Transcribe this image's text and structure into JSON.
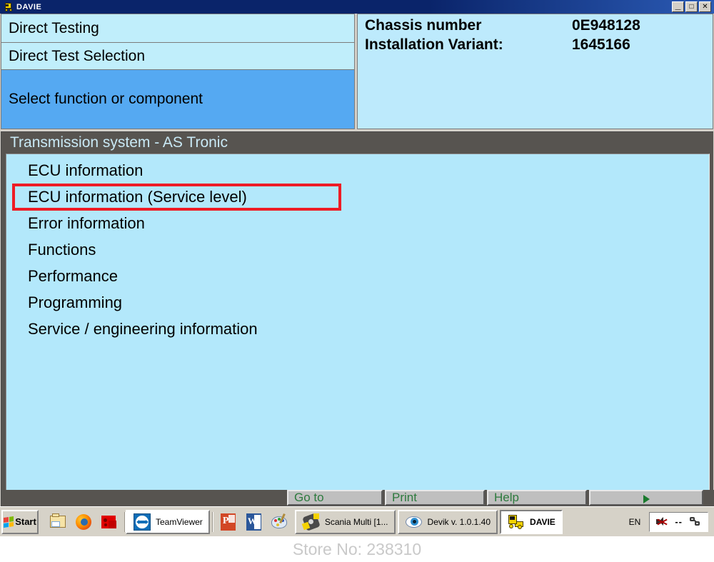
{
  "window": {
    "title": "DAVIE",
    "icon": "truck-icon",
    "controls": {
      "minimize": "_",
      "maximize": "□",
      "close": "✕"
    }
  },
  "breadcrumbs": [
    {
      "label": "Direct Testing",
      "selected": false
    },
    {
      "label": "Direct Test Selection",
      "selected": false
    },
    {
      "label": "Select function or component",
      "selected": true
    }
  ],
  "vehicle_info": [
    {
      "label": "Chassis number",
      "value": "0E948128"
    },
    {
      "label": "Installation Variant:",
      "value": "1645166"
    }
  ],
  "list": {
    "header": "Transmission system - AS Tronic",
    "items": [
      {
        "label": "ECU information",
        "highlighted": false
      },
      {
        "label": "ECU information (Service level)",
        "highlighted": true
      },
      {
        "label": "Error information",
        "highlighted": false
      },
      {
        "label": "Functions",
        "highlighted": false
      },
      {
        "label": "Performance",
        "highlighted": false
      },
      {
        "label": "Programming",
        "highlighted": false
      },
      {
        "label": "Service / engineering information",
        "highlighted": false
      }
    ],
    "highlight_color": "#ee1c25"
  },
  "function_buttons": [
    {
      "label": "Go to"
    },
    {
      "label": "Print"
    },
    {
      "label": "Help"
    },
    {
      "label": ""
    }
  ],
  "taskbar": {
    "start_label": "Start",
    "quick_launch": [
      {
        "icon": "explorer-icon"
      },
      {
        "icon": "firefox-icon"
      },
      {
        "icon": "red-tool-icon"
      }
    ],
    "items": [
      {
        "label": "TeamViewer",
        "icon": "teamviewer-icon",
        "state": "normal"
      },
      {
        "label": "",
        "icon": "powerpoint-icon",
        "state": "icon-only"
      },
      {
        "label": "",
        "icon": "word-icon",
        "state": "icon-only"
      },
      {
        "label": "",
        "icon": "paint-icon",
        "state": "icon-only"
      },
      {
        "label": "Scania Multi   [1...",
        "icon": "scania-icon",
        "state": "normal"
      },
      {
        "label": "Devik v. 1.0.1.40",
        "icon": "devik-eye-icon",
        "state": "normal"
      },
      {
        "label": "DAVIE",
        "icon": "davie-truck-icon",
        "state": "active"
      }
    ],
    "tray": {
      "language": "EN",
      "volume_icon": "volume-muted-icon",
      "dashes": "--",
      "network_icon": "network-icon"
    }
  },
  "watermark": {
    "text": "Store No: 238310"
  }
}
